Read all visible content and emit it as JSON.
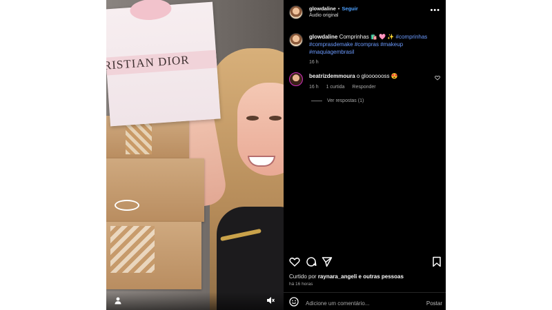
{
  "header": {
    "username": "glowdaline",
    "separator": "•",
    "follow_label": "Seguir",
    "audio_label": "Áudio original",
    "more_label": "•••"
  },
  "caption": {
    "username": "glowdaline",
    "text": "Comprinhas 🛍️ 🩷 ✨",
    "hashtags": [
      "#comprinhas",
      "#comprasdemake",
      "#compras",
      "#makeup",
      "#maquiagembrasil"
    ],
    "time": "16 h"
  },
  "comment": {
    "username": "beatrizdemmoura",
    "text": "o glooooooss 😍",
    "time": "16 h",
    "likes": "1 curtida",
    "reply_label": "Responder"
  },
  "replies": {
    "label": "Ver respostas (1)"
  },
  "media": {
    "brand_text": "RISTIAN DIOR"
  },
  "likes": {
    "prefix": "Curtido por",
    "user": "raynara_angeli",
    "suffix": "e outras pessoas"
  },
  "post_age": "há 16 horas",
  "add_comment": {
    "placeholder": "Adicione um comentário...",
    "post_label": "Postar"
  },
  "colors": {
    "sidebar_bg": "#000000",
    "link": "#4ea1ff",
    "hashtag": "#6c9bff",
    "muted": "#a8a8a8"
  },
  "icons": {
    "like": "heart-icon",
    "comment": "comment-icon",
    "share": "share-icon",
    "save": "bookmark-icon",
    "emoji": "emoji-icon",
    "user_tag": "user-icon",
    "mute": "speaker-muted-icon"
  }
}
